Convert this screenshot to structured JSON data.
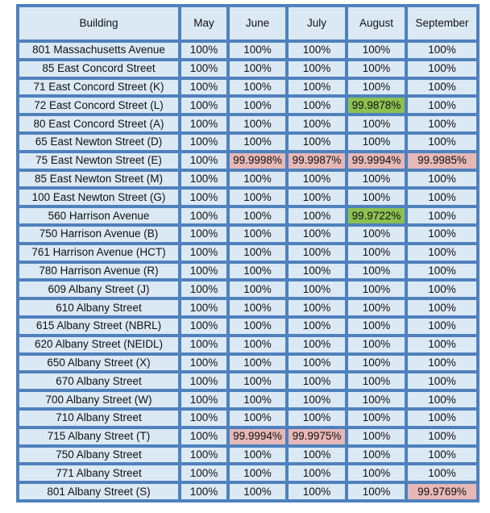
{
  "table": {
    "headers": [
      "Building",
      "May",
      "June",
      "July",
      "August",
      "September"
    ],
    "highlight_colors": {
      "red": "#e6b8b7",
      "green": "#8cc152"
    },
    "rows": [
      {
        "building": "801 Massachusetts Avenue",
        "values": [
          "100%",
          "100%",
          "100%",
          "100%",
          "100%"
        ],
        "hl": [
          "",
          "",
          "",
          "",
          ""
        ]
      },
      {
        "building": "85 East Concord Street",
        "values": [
          "100%",
          "100%",
          "100%",
          "100%",
          "100%"
        ],
        "hl": [
          "",
          "",
          "",
          "",
          ""
        ]
      },
      {
        "building": "71 East Concord Street (K)",
        "values": [
          "100%",
          "100%",
          "100%",
          "100%",
          "100%"
        ],
        "hl": [
          "",
          "",
          "",
          "",
          ""
        ]
      },
      {
        "building": "72 East Concord Street (L)",
        "values": [
          "100%",
          "100%",
          "100%",
          "99.9878%",
          "100%"
        ],
        "hl": [
          "",
          "",
          "",
          "green",
          ""
        ]
      },
      {
        "building": "80 East Concord Street (A)",
        "values": [
          "100%",
          "100%",
          "100%",
          "100%",
          "100%"
        ],
        "hl": [
          "",
          "",
          "",
          "",
          ""
        ]
      },
      {
        "building": "65 East Newton Street (D)",
        "values": [
          "100%",
          "100%",
          "100%",
          "100%",
          "100%"
        ],
        "hl": [
          "",
          "",
          "",
          "",
          ""
        ]
      },
      {
        "building": "75 East Newton Street (E)",
        "values": [
          "100%",
          "99.9998%",
          "99.9987%",
          "99.9994%",
          "99.9985%"
        ],
        "hl": [
          "",
          "red",
          "red",
          "red",
          "red"
        ]
      },
      {
        "building": "85 East Newton Street (M)",
        "values": [
          "100%",
          "100%",
          "100%",
          "100%",
          "100%"
        ],
        "hl": [
          "",
          "",
          "",
          "",
          ""
        ]
      },
      {
        "building": "100 East Newton Street (G)",
        "values": [
          "100%",
          "100%",
          "100%",
          "100%",
          "100%"
        ],
        "hl": [
          "",
          "",
          "",
          "",
          ""
        ]
      },
      {
        "building": "560 Harrison Avenue",
        "values": [
          "100%",
          "100%",
          "100%",
          "99.9722%",
          "100%"
        ],
        "hl": [
          "",
          "",
          "",
          "green",
          ""
        ]
      },
      {
        "building": "750 Harrison Avenue (B)",
        "values": [
          "100%",
          "100%",
          "100%",
          "100%",
          "100%"
        ],
        "hl": [
          "",
          "",
          "",
          "",
          ""
        ]
      },
      {
        "building": "761 Harrison Avenue (HCT)",
        "values": [
          "100%",
          "100%",
          "100%",
          "100%",
          "100%"
        ],
        "hl": [
          "",
          "",
          "",
          "",
          ""
        ]
      },
      {
        "building": "780 Harrison Avenue (R)",
        "values": [
          "100%",
          "100%",
          "100%",
          "100%",
          "100%"
        ],
        "hl": [
          "",
          "",
          "",
          "",
          ""
        ]
      },
      {
        "building": "609 Albany Street (J)",
        "values": [
          "100%",
          "100%",
          "100%",
          "100%",
          "100%"
        ],
        "hl": [
          "",
          "",
          "",
          "",
          ""
        ]
      },
      {
        "building": "610 Albany Street",
        "values": [
          "100%",
          "100%",
          "100%",
          "100%",
          "100%"
        ],
        "hl": [
          "",
          "",
          "",
          "",
          ""
        ]
      },
      {
        "building": "615 Albany Street (NBRL)",
        "values": [
          "100%",
          "100%",
          "100%",
          "100%",
          "100%"
        ],
        "hl": [
          "",
          "",
          "",
          "",
          ""
        ]
      },
      {
        "building": "620 Albany Street (NEIDL)",
        "values": [
          "100%",
          "100%",
          "100%",
          "100%",
          "100%"
        ],
        "hl": [
          "",
          "",
          "",
          "",
          ""
        ]
      },
      {
        "building": "650 Albany Street (X)",
        "values": [
          "100%",
          "100%",
          "100%",
          "100%",
          "100%"
        ],
        "hl": [
          "",
          "",
          "",
          "",
          ""
        ]
      },
      {
        "building": "670 Albany Street",
        "values": [
          "100%",
          "100%",
          "100%",
          "100%",
          "100%"
        ],
        "hl": [
          "",
          "",
          "",
          "",
          ""
        ]
      },
      {
        "building": "700 Albany Street (W)",
        "values": [
          "100%",
          "100%",
          "100%",
          "100%",
          "100%"
        ],
        "hl": [
          "",
          "",
          "",
          "",
          ""
        ]
      },
      {
        "building": "710 Albany Street",
        "values": [
          "100%",
          "100%",
          "100%",
          "100%",
          "100%"
        ],
        "hl": [
          "",
          "",
          "",
          "",
          ""
        ]
      },
      {
        "building": "715 Albany Street (T)",
        "values": [
          "100%",
          "99.9994%",
          "99.9975%",
          "100%",
          "100%"
        ],
        "hl": [
          "",
          "red",
          "red",
          "",
          ""
        ]
      },
      {
        "building": "750 Albany Street",
        "values": [
          "100%",
          "100%",
          "100%",
          "100%",
          "100%"
        ],
        "hl": [
          "",
          "",
          "",
          "",
          ""
        ]
      },
      {
        "building": "771 Albany Street",
        "values": [
          "100%",
          "100%",
          "100%",
          "100%",
          "100%"
        ],
        "hl": [
          "",
          "",
          "",
          "",
          ""
        ]
      },
      {
        "building": "801 Albany Street (S)",
        "values": [
          "100%",
          "100%",
          "100%",
          "100%",
          "99.9769%"
        ],
        "hl": [
          "",
          "",
          "",
          "",
          "red"
        ]
      }
    ]
  }
}
